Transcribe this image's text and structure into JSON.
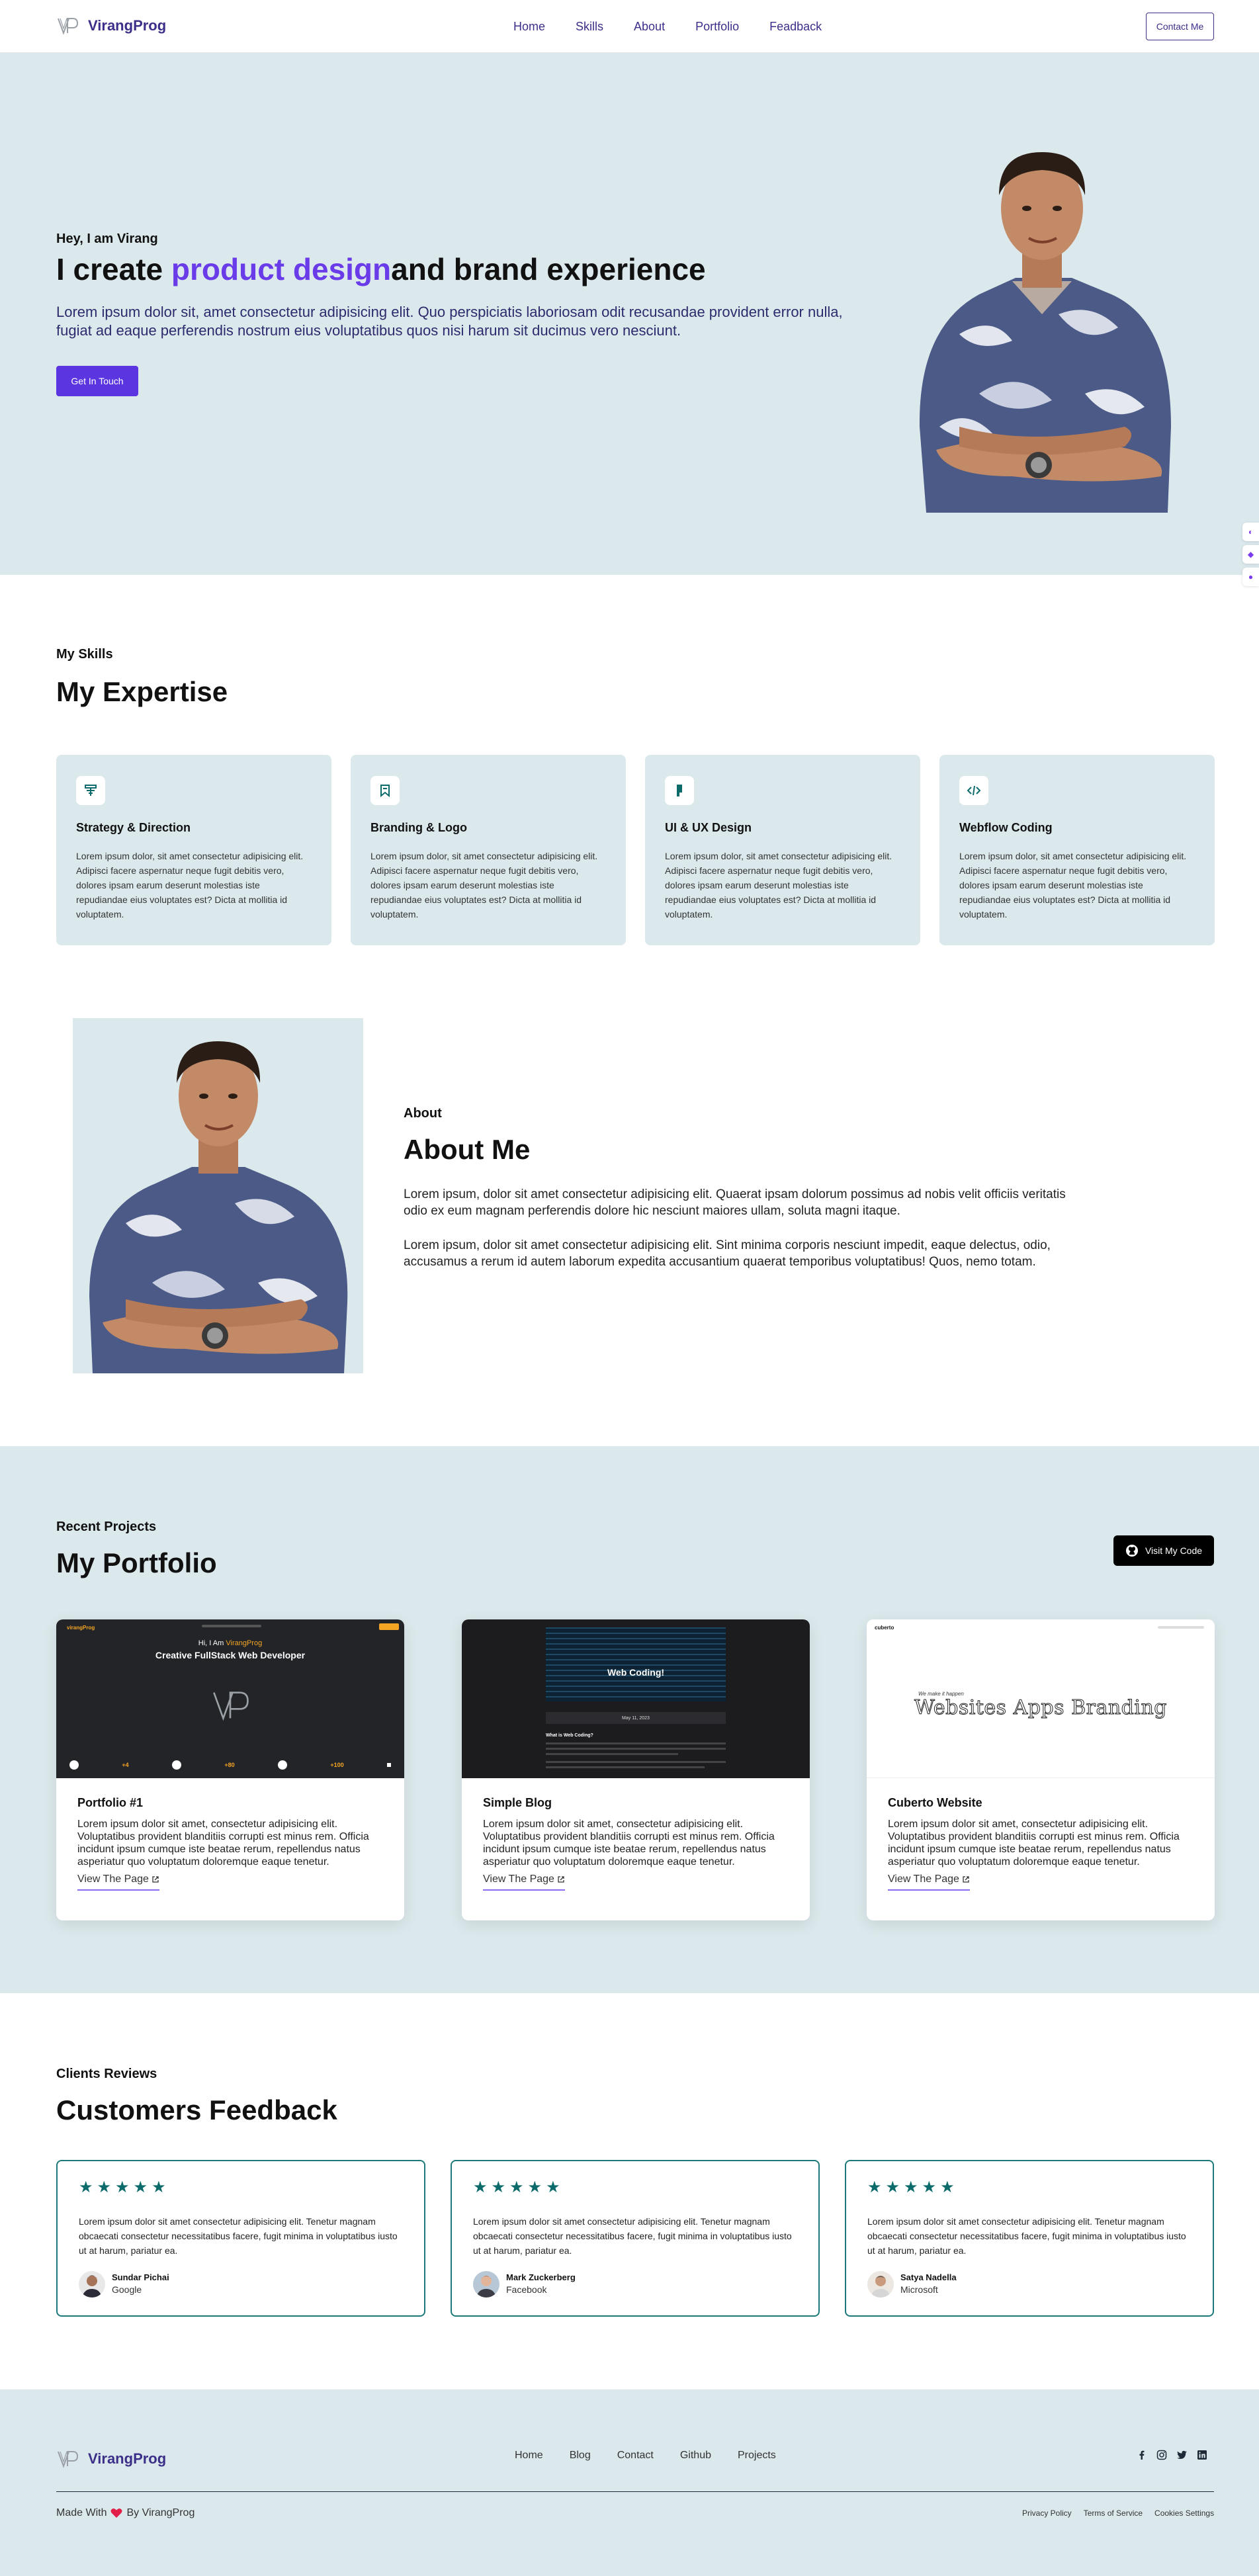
{
  "nav": {
    "brand": "VirangProg",
    "links": [
      "Home",
      "Skills",
      "About",
      "Portfolio",
      "Feadback"
    ],
    "cta": "Contact Me"
  },
  "hero": {
    "eyebrow": "Hey, I am Virang",
    "title_pre": "I create ",
    "title_accent": "product design",
    "title_post": "and brand experience",
    "description": "Lorem ipsum dolor sit, amet consectetur adipisicing elit. Quo perspiciatis laboriosam odit recusandae provident error nulla, fugiat ad eaque perferendis nostrum eius voluptatibus quos nisi harum sit ducimus vero nesciunt.",
    "button": "Get In Touch"
  },
  "skills": {
    "eyebrow": "My Skills",
    "title": "My Expertise",
    "cards": [
      {
        "icon": "strategy-icon",
        "title": "Strategy & Direction",
        "desc": "Lorem ipsum dolor, sit amet consectetur adipisicing elit. Adipisci facere aspernatur neque fugit debitis vero, dolores ipsam earum deserunt molestias iste repudiandae eius voluptates est? Dicta at mollitia id voluptatem."
      },
      {
        "icon": "bookmark-icon",
        "title": "Branding & Logo",
        "desc": "Lorem ipsum dolor, sit amet consectetur adipisicing elit. Adipisci facere aspernatur neque fugit debitis vero, dolores ipsam earum deserunt molestias iste repudiandae eius voluptates est? Dicta at mollitia id voluptatem."
      },
      {
        "icon": "figma-icon",
        "title": "UI & UX Design",
        "desc": "Lorem ipsum dolor, sit amet consectetur adipisicing elit. Adipisci facere aspernatur neque fugit debitis vero, dolores ipsam earum deserunt molestias iste repudiandae eius voluptates est? Dicta at mollitia id voluptatem."
      },
      {
        "icon": "code-icon",
        "title": "Webflow Coding",
        "desc": "Lorem ipsum dolor, sit amet consectetur adipisicing elit. Adipisci facere aspernatur neque fugit debitis vero, dolores ipsam earum deserunt molestias iste repudiandae eius voluptates est? Dicta at mollitia id voluptatem."
      }
    ]
  },
  "about": {
    "eyebrow": "About",
    "title": "About Me",
    "p1": "Lorem ipsum, dolor sit amet consectetur adipisicing elit. Quaerat ipsam dolorum possimus ad nobis velit officiis veritatis odio ex eum magnam perferendis dolore hic nesciunt maiores ullam, soluta magni itaque.",
    "p2": "Lorem ipsum, dolor sit amet consectetur adipisicing elit. Sint minima corporis nesciunt impedit, eaque delectus, odio, accusamus a rerum id autem laborum expedita accusantium quaerat temporibus voluptatibus! Quos, nemo totam."
  },
  "portfolio": {
    "eyebrow": "Recent Projects",
    "title": "My Portfolio",
    "button": "Visit My Code",
    "projects": [
      {
        "title": "Portfolio #1",
        "desc": "Lorem ipsum dolor sit amet, consectetur adipisicing elit. Voluptatibus provident blanditiis corrupti est minus rem. Officia incidunt ipsum cumque iste beatae rerum, repellendus natus asperiatur quo voluptatum doloremque eaque tenetur.",
        "link": "View The Page",
        "thumb": {
          "brand": "virangProg",
          "greeting": "Hi, I Am ",
          "greeting_name": "VirangProg",
          "headline": "Creative FullStack Web Developer",
          "stats": [
            "+4",
            "+80",
            "+100"
          ]
        }
      },
      {
        "title": "Simple Blog",
        "desc": "Lorem ipsum dolor sit amet, consectetur adipisicing elit. Voluptatibus provident blanditiis corrupti est minus rem. Officia incidunt ipsum cumque iste beatae rerum, repellendus natus asperiatur quo voluptatum doloremque eaque tenetur.",
        "link": "View The Page",
        "thumb": {
          "headline": "Web Coding!",
          "date": "May 11, 2023",
          "section": "What is Web Coding?"
        }
      },
      {
        "title": "Cuberto Website",
        "desc": "Lorem ipsum dolor sit amet, consectetur adipisicing elit. Voluptatibus provident blanditiis corrupti est minus rem. Officia incidunt ipsum cumque iste beatae rerum, repellendus natus asperiatur quo voluptatum doloremque eaque tenetur.",
        "link": "View The Page",
        "thumb": {
          "brand": "cuberto",
          "tagline": "We make it happen",
          "headline": "Websites Apps Branding"
        }
      }
    ]
  },
  "feedback": {
    "eyebrow": "Clients Reviews",
    "title": "Customers Feedback",
    "reviews": [
      {
        "stars": 5,
        "text": "Lorem ipsum dolor sit amet consectetur adipisicing elit. Tenetur magnam obcaecati consectetur necessitatibus facere, fugit minima in voluptatibus iusto ut at harum, pariatur ea.",
        "name": "Sundar Pichai",
        "company": "Google"
      },
      {
        "stars": 5,
        "text": "Lorem ipsum dolor sit amet consectetur adipisicing elit. Tenetur magnam obcaecati consectetur necessitatibus facere, fugit minima in voluptatibus iusto ut at harum, pariatur ea.",
        "name": "Mark Zuckerberg",
        "company": "Facebook"
      },
      {
        "stars": 5,
        "text": "Lorem ipsum dolor sit amet consectetur adipisicing elit. Tenetur magnam obcaecati consectetur necessitatibus facere, fugit minima in voluptatibus iusto ut at harum, pariatur ea.",
        "name": "Satya Nadella",
        "company": "Microsoft"
      }
    ]
  },
  "footer": {
    "brand": "VirangProg",
    "links": [
      "Home",
      "Blog",
      "Contact",
      "Github",
      "Projects"
    ],
    "social": [
      "facebook-icon",
      "instagram-icon",
      "twitter-icon",
      "linkedin-icon"
    ],
    "made_pre": "Made With",
    "made_post": "By VirangProg",
    "legal": [
      "Privacy Policy",
      "Terms of Service",
      "Cookies Settings"
    ]
  },
  "colors": {
    "accent": "#6a3be8",
    "button": "#5b36e0",
    "section_bg": "#dce9ec",
    "brand_text": "#3b2f8a",
    "review_border": "#1b7a79"
  }
}
